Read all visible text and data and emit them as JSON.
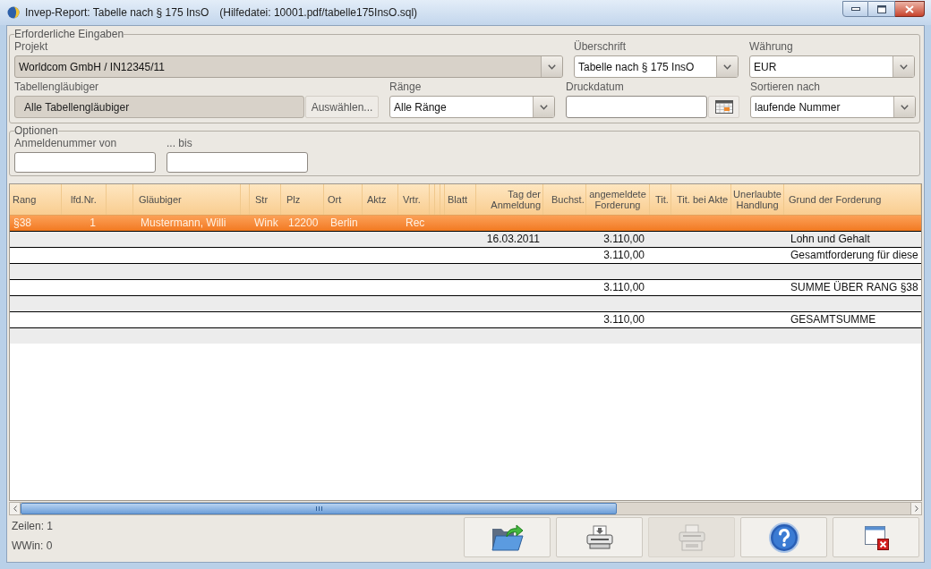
{
  "window": {
    "title": "Invep-Report: Tabelle nach § 175 InsO",
    "help_file": "(Hilfedatei: 10001.pdf/tabelle175InsO.sql)"
  },
  "required_inputs": {
    "legend": "Erforderliche Eingaben",
    "fields": [
      {
        "kind": "combo",
        "label": "Projekt",
        "value": "Worldcom GmbH / IN12345/11",
        "disabled": true
      },
      {
        "kind": "combo",
        "label": "Überschrift",
        "value": "Tabelle nach § 175 InsO",
        "disabled": false
      },
      {
        "kind": "combo",
        "label": "Währung",
        "value": "EUR",
        "disabled": false
      },
      {
        "kind": "picker",
        "label": "Tabellengläubiger",
        "value": "Alle Tabellengläubiger",
        "disabled": true,
        "button": "Auswählen..."
      },
      {
        "kind": "combo",
        "label": "Ränge",
        "value": "Alle Ränge",
        "disabled": false
      },
      {
        "kind": "date",
        "label": "Druckdatum"
      },
      {
        "kind": "combo",
        "label": "Sortieren nach",
        "value": "laufende Nummer",
        "disabled": false
      }
    ]
  },
  "options": {
    "legend": "Optionen",
    "fields": [
      {
        "label": "Anmeldenummer von"
      },
      {
        "label": "... bis"
      }
    ]
  },
  "table": {
    "columns": [
      "Rang",
      "lfd.Nr.",
      "Gläubiger",
      "Str",
      "Plz",
      "Ort",
      "Aktz",
      "Vrtr.",
      "Blatt",
      "Tag der Anmeldung",
      "Buchst.",
      "angemeldete Forderung",
      "Tit.",
      "Tit. bei Akte",
      "Unerlaubte Handlung",
      "Grund der Forderung"
    ],
    "rows": [
      {
        "selected": true,
        "rang": "§38",
        "lfd_nr": "1",
        "glaeubiger": "Mustermann, Willi",
        "str": "Wink",
        "plz": "12200",
        "ort": "Berlin",
        "vrtr": "Rec"
      },
      {
        "selected": false,
        "tag_der_anmeldung": "16.03.2011",
        "angemeldete_forderung": "3.110,00",
        "grund_der_forderung": "Lohn und Gehalt"
      },
      {
        "selected": false,
        "angemeldete_forderung": "3.110,00",
        "grund_der_forderung": "Gesamtforderung für diese"
      },
      {
        "selected": false
      },
      {
        "selected": false,
        "angemeldete_forderung": "3.110,00",
        "grund_der_forderung": "SUMME ÜBER RANG §38"
      },
      {
        "selected": false
      },
      {
        "selected": false,
        "angemeldete_forderung": "3.110,00",
        "grund_der_forderung": "GESAMTSUMME"
      },
      {
        "selected": false
      }
    ]
  },
  "status": [
    "Zeilen: 1",
    "WWin: 0"
  ],
  "buttons": [
    {
      "kind": "folder",
      "disabled": false
    },
    {
      "kind": "printer",
      "disabled": false
    },
    {
      "kind": "printer_stack",
      "disabled": true
    },
    {
      "kind": "help",
      "disabled": false
    },
    {
      "kind": "window_close",
      "disabled": false
    }
  ]
}
